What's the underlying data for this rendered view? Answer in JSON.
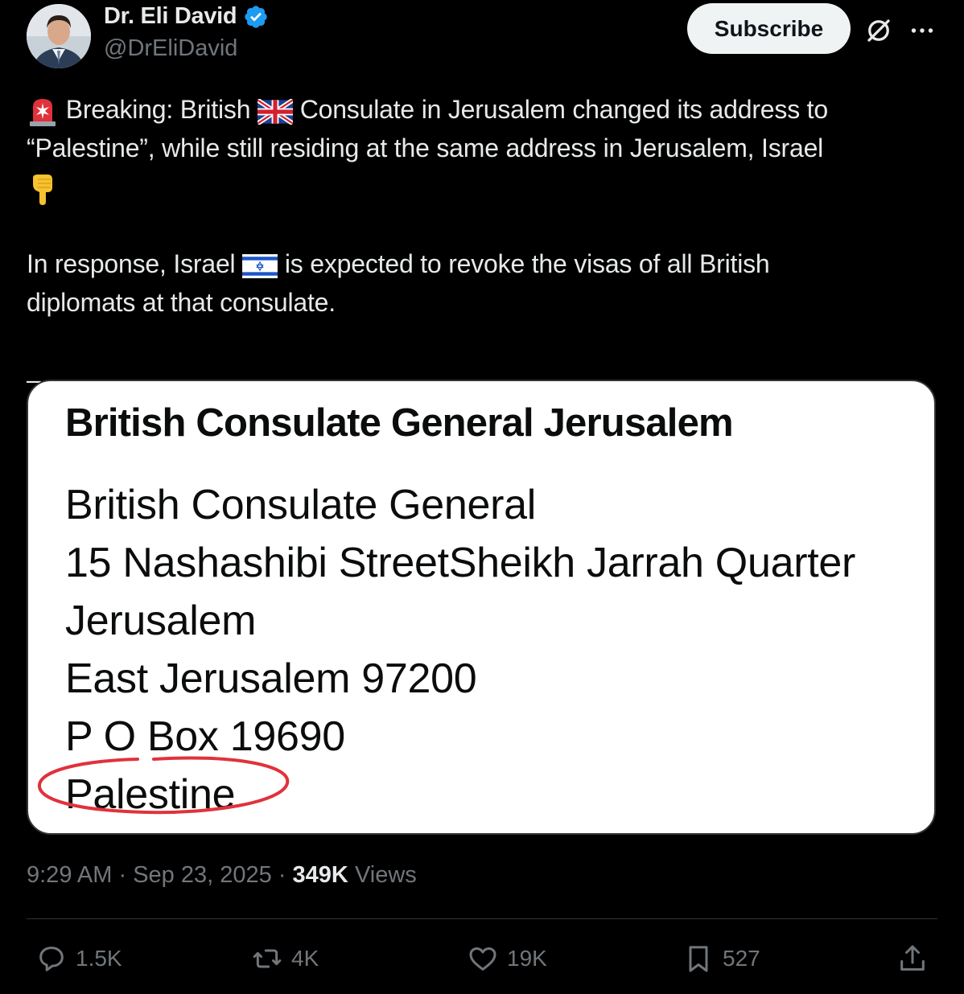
{
  "author": {
    "display_name": "Dr. Eli David",
    "handle": "@DrEliDavid",
    "verified_badge_icon": "verified-badge-icon",
    "avatar_icon": "avatar"
  },
  "header": {
    "subscribe_label": "Subscribe",
    "grok_icon": "grok-icon",
    "more_icon": "more-icon"
  },
  "tweet": {
    "line1_emoji": "police-light-emoji",
    "line1_a": "Breaking: British",
    "line1_flag": "uk-flag-emoji",
    "line1_b": "Consulate in Jerusalem changed its address to",
    "line2": "“Palestine”, while still residing at the same address in Jerusalem, Israel",
    "line3_emoji": "pointing-down-emoji",
    "para2_a": "In response, Israel",
    "para2_flag": "israel-flag-emoji",
    "para2_b": "is expected to revoke the visas of all British",
    "para2_c": "diplomats at that consulate.",
    "dash": "–"
  },
  "card": {
    "heading": "British Consulate General Jerusalem",
    "lines": [
      "British Consulate General",
      "15 Nashashibi StreetSheikh Jarrah Quarter",
      "Jerusalem",
      "East Jerusalem 97200",
      "P O Box 19690",
      "Palestine"
    ],
    "highlight_color": "#e0323c"
  },
  "meta": {
    "time": "9:29 AM",
    "sep1": "·",
    "date": "Sep 23, 2025",
    "sep2": "·",
    "views_count": "349K",
    "views_label": "Views"
  },
  "actions": {
    "replies": "1.5K",
    "reposts": "4K",
    "likes": "19K",
    "bookmarks": "527"
  },
  "colors": {
    "background": "#000000",
    "text": "#e7e9ea",
    "muted": "#71767b",
    "verified": "#1d9bf0"
  }
}
